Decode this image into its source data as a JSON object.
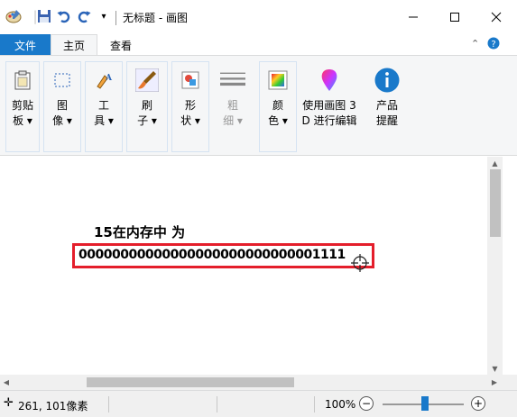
{
  "window": {
    "title": "无标题 - 画图",
    "minimize_icon": "minimize-icon",
    "maximize_icon": "maximize-icon",
    "close_icon": "close-icon"
  },
  "quick_access": {
    "app_icon": "paint-app-icon",
    "save_icon": "save-icon",
    "undo_icon": "undo-icon",
    "redo_icon": "redo-icon",
    "customize_icon": "dropdown-arrow-icon"
  },
  "tabs": {
    "file": "文件",
    "home": "主页",
    "view": "查看"
  },
  "ribbon": {
    "clipboard": "剪贴\n板 ▾",
    "image": "图\n像 ▾",
    "tools": "工\n具 ▾",
    "brushes": "刷\n子 ▾",
    "shapes": "形\n状 ▾",
    "size": "粗\n细 ▾",
    "colors": "颜\n色 ▾",
    "paint3d": "使用画图 3\nD 进行编辑",
    "product_alert": "产品\n提醒"
  },
  "canvas": {
    "caption": "15在内存中 为",
    "binary_value": "00000000000000000000000000001111"
  },
  "status": {
    "coordinates": "261, 101像素",
    "zoom": "100%",
    "zoom_fraction": 0.5
  },
  "colors": {
    "accent": "#1979ca",
    "highlight_border": "#e41e2b"
  }
}
